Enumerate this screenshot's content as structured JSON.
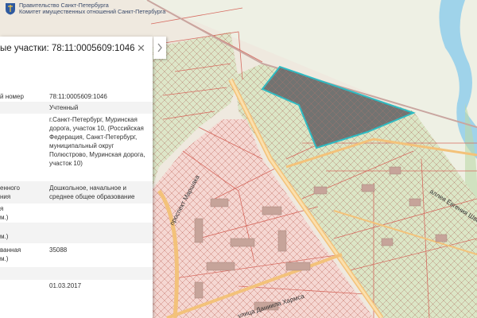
{
  "header": {
    "org_line1": "Правительство Санкт-Петербурга",
    "org_line2": "Комитет имущественных отношений Санкт-Петербурга"
  },
  "panel": {
    "title": "ые участки: 78:11:0005609:1046",
    "close_icon": "close-icon",
    "toggle_icon": "chevron-right-icon",
    "rows": [
      {
        "label": "й номер",
        "value": "78:11:0005609:1046"
      },
      {
        "label": "",
        "value": "Учтенный"
      },
      {
        "label": "",
        "value": "г.Санкт-Петербург, Муринская дорога, участок 10, (Российская Федерация, Санкт-Петербург, муниципальный округ Полюстрово, Муринская дорога, участок 10)"
      },
      {
        "label": "енного\nния",
        "value": "Дошкольное, начальное и среднее общее образование"
      },
      {
        "label": "я\nм.)",
        "value": ""
      },
      {
        "label": "м.)",
        "value": ""
      },
      {
        "label": "ванная\nм.)",
        "value": "35088"
      },
      {
        "label": "",
        "value": ""
      },
      {
        "label": "",
        "value": "01.03.2017"
      }
    ]
  },
  "map": {
    "streets": [
      "проспект Маршака",
      "улица Даниила Хармса",
      "аллея Евгения Шварца"
    ],
    "colors": {
      "background": "#efe9df",
      "pink_zone": "#f5d7d2",
      "green_zone": "#dbe6c6",
      "parcel_line": "#d66a5f",
      "road": "#f3c27a",
      "selected_fill": "#6d6d6d",
      "selected_stroke": "#2bbcc4",
      "water": "#9fd3ea"
    }
  }
}
